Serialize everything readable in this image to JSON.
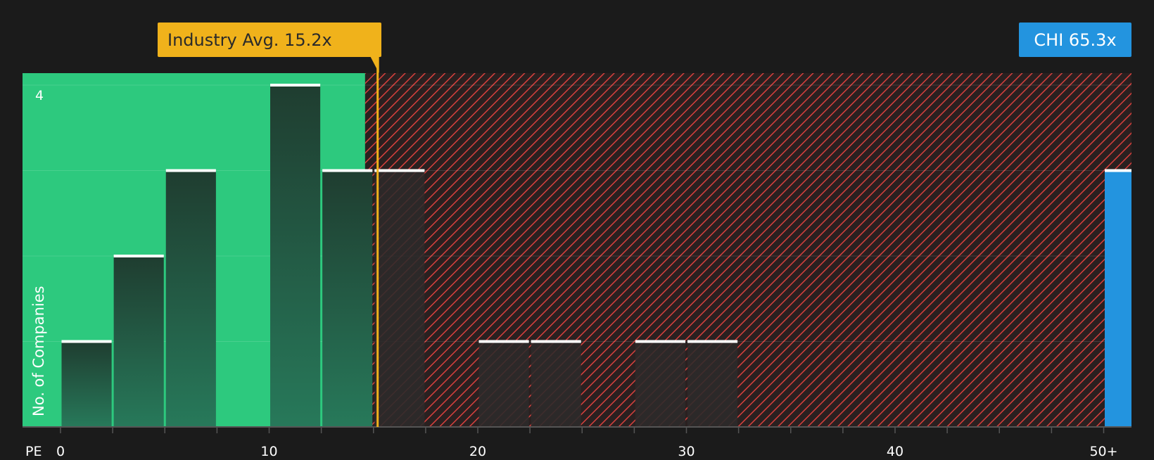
{
  "chart_data": {
    "type": "bar",
    "x_axis_label": "PE",
    "y_axis_label": "No. of Companies",
    "x_ticks": [
      "0",
      "10",
      "20",
      "30",
      "40",
      "50+"
    ],
    "y_tick": "4",
    "ylim": [
      0,
      4
    ],
    "bins": [
      {
        "x0": 0,
        "x1": 2.5,
        "count": 1
      },
      {
        "x0": 2.5,
        "x1": 5,
        "count": 2
      },
      {
        "x0": 5,
        "x1": 7.5,
        "count": 3
      },
      {
        "x0": 7.5,
        "x1": 10,
        "count": 0
      },
      {
        "x0": 10,
        "x1": 12.5,
        "count": 4
      },
      {
        "x0": 12.5,
        "x1": 15,
        "count": 3
      },
      {
        "x0": 15,
        "x1": 17.5,
        "count": 3
      },
      {
        "x0": 17.5,
        "x1": 20,
        "count": 0
      },
      {
        "x0": 20,
        "x1": 22.5,
        "count": 1
      },
      {
        "x0": 22.5,
        "x1": 25,
        "count": 1
      },
      {
        "x0": 25,
        "x1": 27.5,
        "count": 0
      },
      {
        "x0": 27.5,
        "x1": 30,
        "count": 1
      },
      {
        "x0": 30,
        "x1": 32.5,
        "count": 1
      }
    ],
    "company": {
      "label": "CHI 65.3x",
      "pe": 65.3,
      "count": 3
    },
    "industry_avg": {
      "label": "Industry Avg. 15.2x",
      "value": 15.2
    },
    "fair_range_max": 14.6,
    "colors": {
      "background": "#1b1b1b",
      "green_zone": "#2dc97e",
      "red_hatch": "#e0413e",
      "bar_dark": "#1f3d2f",
      "company_bar": "#2394df",
      "avg_line": "#f0b21b",
      "axis": "#555555",
      "text": "#ffffff"
    }
  }
}
